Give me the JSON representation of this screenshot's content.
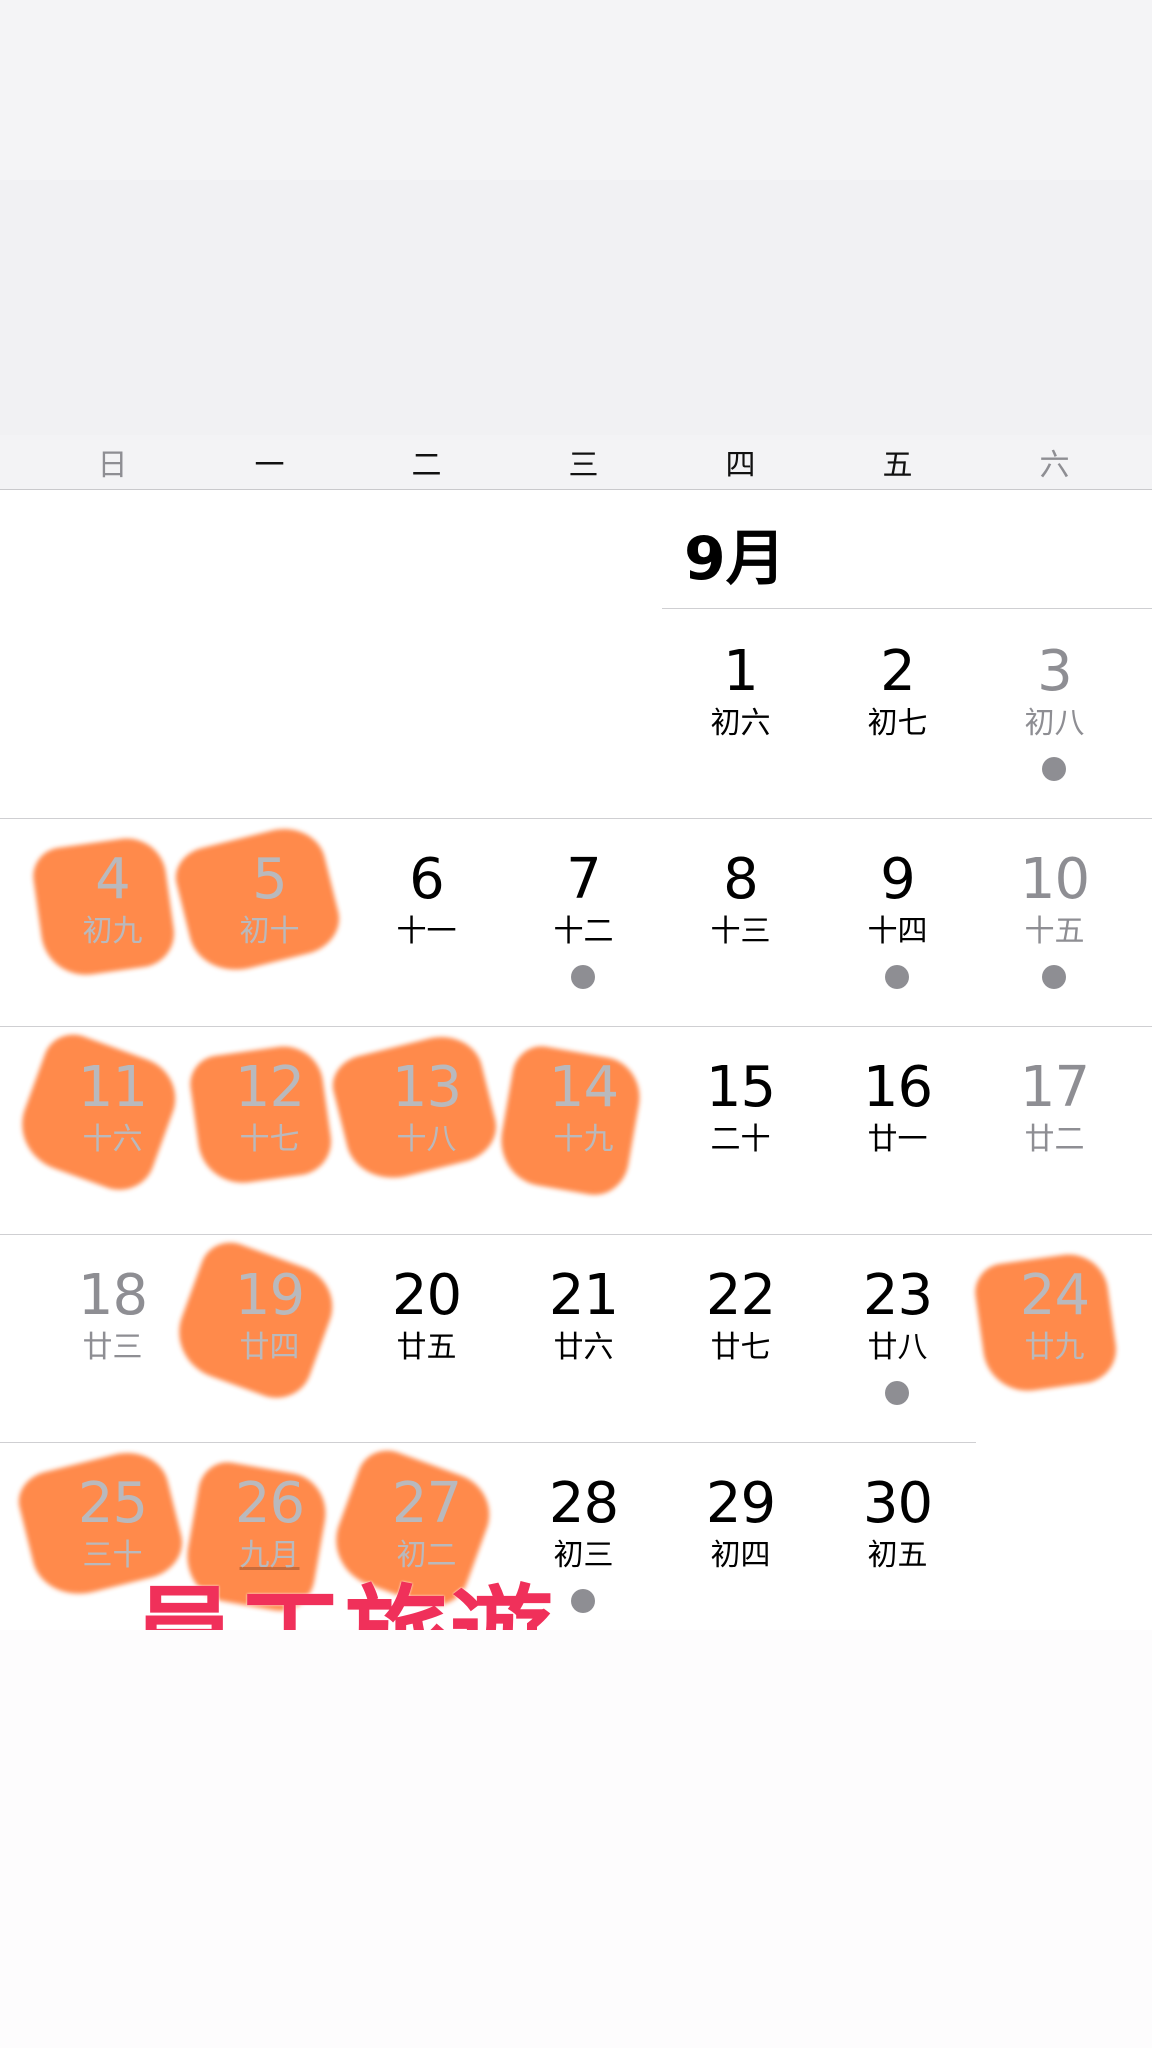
{
  "weekday_header": [
    "日",
    "一",
    "二",
    "三",
    "四",
    "五",
    "六"
  ],
  "month": {
    "label": "9月"
  },
  "days": [
    {
      "n": "1",
      "lunar": "初六"
    },
    {
      "n": "2",
      "lunar": "初七"
    },
    {
      "n": "3",
      "lunar": "初八",
      "event": true
    },
    {
      "n": "4",
      "lunar": "初九",
      "highlighted": true
    },
    {
      "n": "5",
      "lunar": "初十",
      "highlighted": true
    },
    {
      "n": "6",
      "lunar": "十一"
    },
    {
      "n": "7",
      "lunar": "十二",
      "event": true
    },
    {
      "n": "8",
      "lunar": "十三"
    },
    {
      "n": "9",
      "lunar": "十四",
      "event": true
    },
    {
      "n": "10",
      "lunar": "十五",
      "event": true
    },
    {
      "n": "11",
      "lunar": "十六",
      "highlighted": true
    },
    {
      "n": "12",
      "lunar": "十七",
      "highlighted": true
    },
    {
      "n": "13",
      "lunar": "十八",
      "highlighted": true
    },
    {
      "n": "14",
      "lunar": "十九",
      "highlighted": true
    },
    {
      "n": "15",
      "lunar": "二十"
    },
    {
      "n": "16",
      "lunar": "廿一"
    },
    {
      "n": "17",
      "lunar": "廿二"
    },
    {
      "n": "18",
      "lunar": "廿三"
    },
    {
      "n": "19",
      "lunar": "廿四",
      "highlighted": true
    },
    {
      "n": "20",
      "lunar": "廿五"
    },
    {
      "n": "21",
      "lunar": "廿六"
    },
    {
      "n": "22",
      "lunar": "廿七"
    },
    {
      "n": "23",
      "lunar": "廿八",
      "event": true
    },
    {
      "n": "24",
      "lunar": "廿九",
      "highlighted": true
    },
    {
      "n": "25",
      "lunar": "三十",
      "highlighted": true
    },
    {
      "n": "26",
      "lunar": "九月",
      "highlighted": true,
      "today": true
    },
    {
      "n": "27",
      "lunar": "初二",
      "highlighted": true
    },
    {
      "n": "28",
      "lunar": "初三",
      "event": true
    },
    {
      "n": "29",
      "lunar": "初四"
    },
    {
      "n": "30",
      "lunar": "初五"
    }
  ],
  "banner": {
    "text": "員工旅遊"
  },
  "colors": {
    "highlight": "#ff7a33",
    "banner_text": "#f0305a",
    "event_dot": "#8e8e93",
    "weekend_text": "#8e8e93"
  }
}
